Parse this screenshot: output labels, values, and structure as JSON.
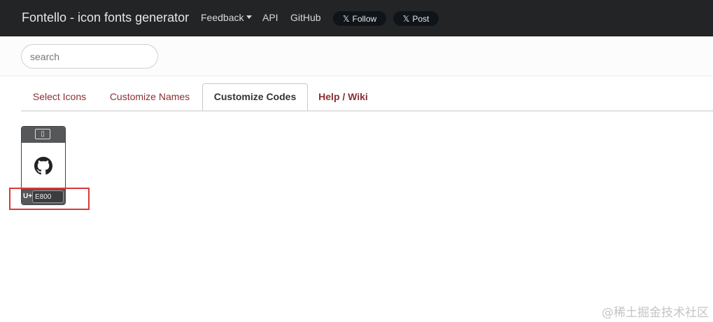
{
  "navbar": {
    "brand": "Fontello - icon fonts generator",
    "links": {
      "feedback": "Feedback",
      "api": "API",
      "github": "GitHub"
    },
    "x_buttons": {
      "logo": "𝕏",
      "follow": "Follow",
      "post": "Post"
    }
  },
  "search": {
    "placeholder": "search",
    "value": ""
  },
  "tabs": [
    {
      "label": "Select Icons"
    },
    {
      "label": "Customize Names"
    },
    {
      "label": "Customize Codes"
    },
    {
      "label": "Help / Wiki"
    }
  ],
  "active_tab": "Customize Codes",
  "glyphs": [
    {
      "icon": "github-icon",
      "code_prefix": "U+",
      "code": "E800"
    }
  ],
  "watermark": "@稀土掘金技术社区",
  "colors": {
    "navbar_bg": "#222426",
    "tab_text": "#8b2f33",
    "highlight": "#d93a3a"
  }
}
